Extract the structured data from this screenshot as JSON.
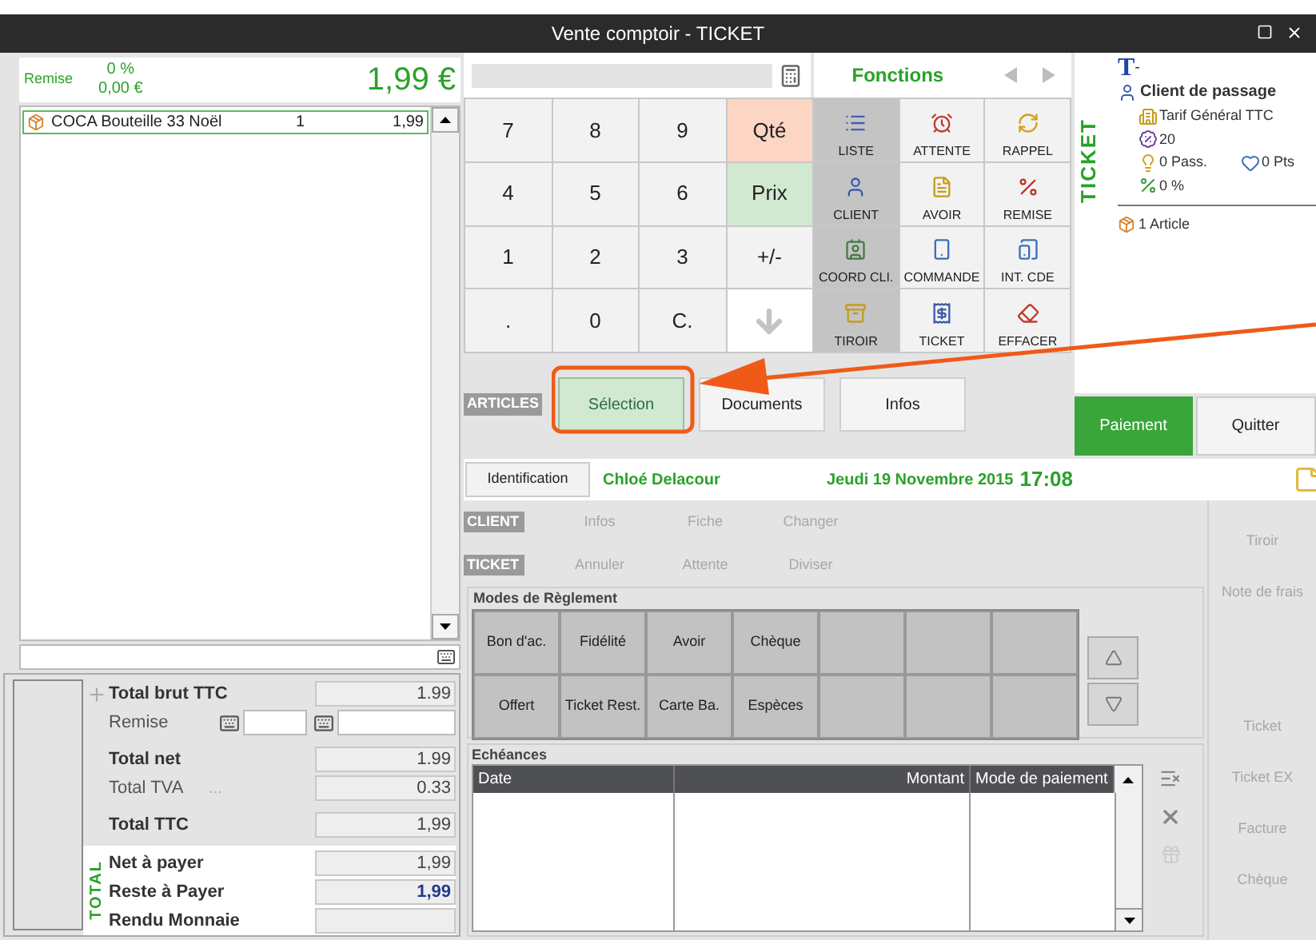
{
  "window": {
    "title": "Vente comptoir - TICKET"
  },
  "summary": {
    "discount_label": "Remise",
    "discount_percent": "0 %",
    "discount_amount": "0,00 €",
    "total": "1,99 €"
  },
  "lines": [
    {
      "name": "COCA Bouteille 33 Noël",
      "qty": "1",
      "price": "1,99",
      "selected": true
    }
  ],
  "keypad": [
    {
      "kind": "key",
      "label": "7",
      "color": "#f2f2f2"
    },
    {
      "kind": "key",
      "label": "8",
      "color": "#f2f2f2"
    },
    {
      "kind": "key",
      "label": "9",
      "color": "#f2f2f2"
    },
    {
      "kind": "key",
      "label": "Qté",
      "color": "#fcd6c2"
    },
    {
      "kind": "key",
      "label": "4",
      "color": "#f2f2f2"
    },
    {
      "kind": "key",
      "label": "5",
      "color": "#f2f2f2"
    },
    {
      "kind": "key",
      "label": "6",
      "color": "#f2f2f2"
    },
    {
      "kind": "key",
      "label": "Prix",
      "color": "#d0e9d0"
    },
    {
      "kind": "key",
      "label": "1",
      "color": "#f2f2f2"
    },
    {
      "kind": "key",
      "label": "2",
      "color": "#f2f2f2"
    },
    {
      "kind": "key",
      "label": "3",
      "color": "#f2f2f2"
    },
    {
      "kind": "key",
      "label": "+/-",
      "color": "#f2f2f2"
    },
    {
      "kind": "key",
      "label": ".",
      "color": "#f2f2f2"
    },
    {
      "kind": "key",
      "label": "0",
      "color": "#f2f2f2"
    },
    {
      "kind": "key",
      "label": "C.",
      "color": "#f2f2f2"
    },
    {
      "kind": "arrow",
      "color": "#ffffff"
    }
  ],
  "functions": {
    "title": "Fonctions",
    "items": [
      {
        "label": "LISTE",
        "highlighted": true
      },
      {
        "label": "ATTENTE",
        "highlighted": false
      },
      {
        "label": "RAPPEL",
        "highlighted": false
      },
      {
        "label": "CLIENT",
        "highlighted": true
      },
      {
        "label": "AVOIR",
        "highlighted": false
      },
      {
        "label": "REMISE",
        "highlighted": false
      },
      {
        "label": "COORD CLI.",
        "highlighted": true
      },
      {
        "label": "COMMANDE",
        "highlighted": false
      },
      {
        "label": "INT. CDE",
        "highlighted": false
      },
      {
        "label": "TIROIR",
        "highlighted": true
      },
      {
        "label": "TICKET",
        "highlighted": false
      },
      {
        "label": "EFFACER",
        "highlighted": false
      }
    ]
  },
  "articles": {
    "label": "ARTICLES",
    "tabs": [
      {
        "label": "Sélection",
        "selected": true
      },
      {
        "label": "Documents",
        "selected": false
      },
      {
        "label": "Infos",
        "selected": false
      }
    ]
  },
  "ticket": {
    "title": "TICKET",
    "code": "T",
    "number": "-",
    "client": "Client de passage",
    "tariff": "Tarif Général TTC",
    "vat": "20",
    "passages": "0 Pass.",
    "points": "0 Pts",
    "discount": "0 %",
    "articles": "1 Article"
  },
  "actions": [
    {
      "label": "Paiement",
      "kind": "primary"
    },
    {
      "label": "Quitter",
      "kind": "normal"
    }
  ],
  "status": {
    "button": "Identification",
    "user": "Chloé Delacour",
    "date": "Jeudi 19 Novembre 2015",
    "time": "17:08"
  },
  "quick_actions": [
    {
      "label": "CLIENT",
      "items": [
        {
          "label": "Infos",
          "disabled": true
        },
        {
          "label": "Fiche",
          "disabled": true
        },
        {
          "label": "Changer",
          "disabled": true
        }
      ]
    },
    {
      "label": "TICKET",
      "items": [
        {
          "label": "Annuler",
          "disabled": true
        },
        {
          "label": "Attente",
          "disabled": true
        },
        {
          "label": "Diviser",
          "disabled": true
        }
      ]
    }
  ],
  "payment_modes": {
    "title": "Modes de Règlement",
    "rows": [
      [
        "Bon d'ac.",
        "Fidélité",
        "Avoir",
        "Chèque"
      ],
      [
        "Offert",
        "Ticket Rest.",
        "Carte Ba.",
        "Espèces"
      ]
    ]
  },
  "schedule": {
    "title": "Echéances",
    "columns": [
      "Date",
      "Montant",
      "Mode de paiement"
    ]
  },
  "side_actions": [
    {
      "label": "Tiroir",
      "disabled": true
    },
    {
      "label": "Note de frais",
      "disabled": true
    },
    {
      "label": "Ticket",
      "disabled": true
    },
    {
      "label": "Ticket EX",
      "disabled": true
    },
    {
      "label": "Facture",
      "disabled": true
    },
    {
      "label": "Chèque",
      "disabled": true
    }
  ],
  "totals": {
    "rows": [
      {
        "kind": "gross",
        "label": "Total brut TTC",
        "value": "1.99"
      },
      {
        "kind": "discount",
        "label": "Remise"
      },
      {
        "kind": "bold",
        "label": "Total net",
        "value": "1.99"
      },
      {
        "kind": "plain",
        "label": "Total TVA",
        "note": "...",
        "value": "0.33"
      },
      {
        "kind": "bold",
        "label": "Total TTC",
        "value": "1,99"
      }
    ],
    "due_title": "TOTAL",
    "due": [
      {
        "kind": "bold",
        "label": "Net à payer",
        "value": "1,99"
      },
      {
        "kind": "emphasis",
        "label": "Reste à Payer",
        "value": "1,99"
      },
      {
        "kind": "bold",
        "label": "Rendu Monnaie"
      }
    ]
  }
}
